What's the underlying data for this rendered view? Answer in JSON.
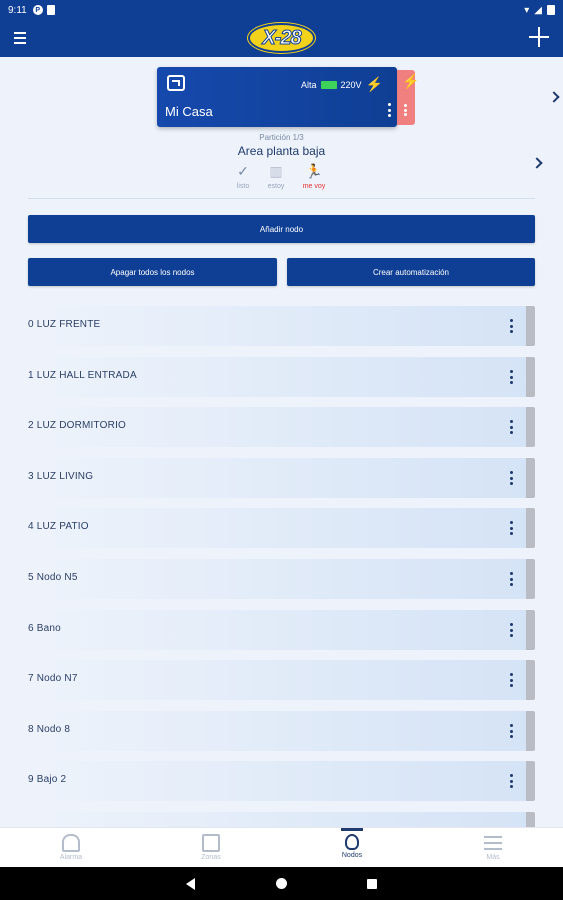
{
  "status_bar": {
    "time": "9:11"
  },
  "app_bar": {
    "logo_text": "X-28"
  },
  "device": {
    "name": "Mi Casa",
    "signal": "Alta",
    "voltage": "220V"
  },
  "partition": {
    "subtitle": "Partición 1/3",
    "name": "Area planta baja"
  },
  "modes": [
    {
      "label": "listo",
      "icon": "check-icon"
    },
    {
      "label": "estoy",
      "icon": "stay-icon"
    },
    {
      "label": "me voy",
      "icon": "walking-person-icon",
      "active": true
    }
  ],
  "actions": {
    "add_node": "Añadir nodo",
    "turn_off_all": "Apagar todos los nodos",
    "create_automation": "Crear automatización"
  },
  "nodes": [
    "0 LUZ FRENTE",
    "1 LUZ HALL ENTRADA",
    "2 LUZ DORMITORIO",
    "3 LUZ LIVING",
    "4 LUZ PATIO",
    "5 Nodo N5",
    "6 Bano",
    "7 Nodo N7",
    "8 Nodo 8",
    "9 Bajo 2"
  ],
  "bottom_nav": [
    {
      "label": "Alarma",
      "icon": "bell-icon"
    },
    {
      "label": "Zonas",
      "icon": "zones-icon"
    },
    {
      "label": "Nodos",
      "icon": "bulb-icon",
      "active": true
    },
    {
      "label": "Más",
      "icon": "menu-icon"
    }
  ],
  "colors": {
    "primary": "#0f3f94",
    "alert": "#e53030",
    "battery": "#3ed25a"
  }
}
